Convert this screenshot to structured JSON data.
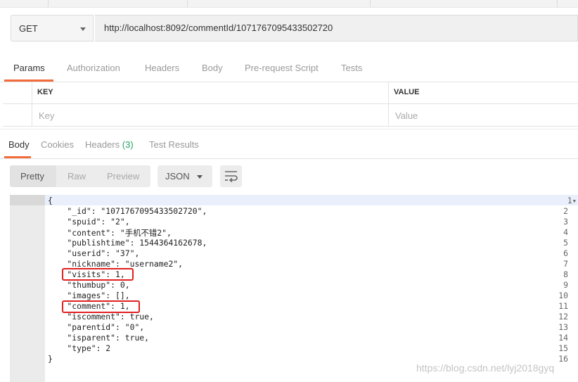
{
  "request": {
    "method": "GET",
    "url": "http://localhost:8092/commentId/1071767095433502720"
  },
  "request_tabs": [
    "Params",
    "Authorization",
    "Headers",
    "Body",
    "Pre-request Script",
    "Tests"
  ],
  "params": {
    "key_header": "KEY",
    "value_header": "VALUE",
    "key_placeholder": "Key",
    "value_placeholder": "Value"
  },
  "response_tabs": {
    "body": "Body",
    "cookies": "Cookies",
    "headers": "Headers",
    "headers_count": "(3)",
    "tests": "Test Results"
  },
  "view": {
    "modes": [
      "Pretty",
      "Raw",
      "Preview"
    ],
    "format": "JSON",
    "wrap_icon": "wrap-lines-icon",
    "fold_icon": "fold-arrow-icon"
  },
  "code_lines": [
    "{",
    "    \"_id\": \"1071767095433502720\",",
    "    \"spuid\": \"2\",",
    "    \"content\": \"手机不错2\",",
    "    \"publishtime\": 1544364162678,",
    "    \"userid\": \"37\",",
    "    \"nickname\": \"username2\",",
    "    \"visits\": 1,",
    "    \"thumbup\": 0,",
    "    \"images\": [],",
    "    \"comment\": 1,",
    "    \"iscomment\": true,",
    "    \"parentid\": \"0\",",
    "    \"isparent\": true,",
    "    \"type\": 2",
    "}"
  ],
  "line_numbers": [
    "1",
    "2",
    "3",
    "4",
    "5",
    "6",
    "7",
    "8",
    "9",
    "10",
    "11",
    "12",
    "13",
    "14",
    "15",
    "16"
  ],
  "watermark": "https://blog.csdn.net/lyj2018gyq",
  "colors": {
    "accent": "#f26b3a",
    "highlight_box": "#e02020",
    "count_green": "#26a269"
  }
}
